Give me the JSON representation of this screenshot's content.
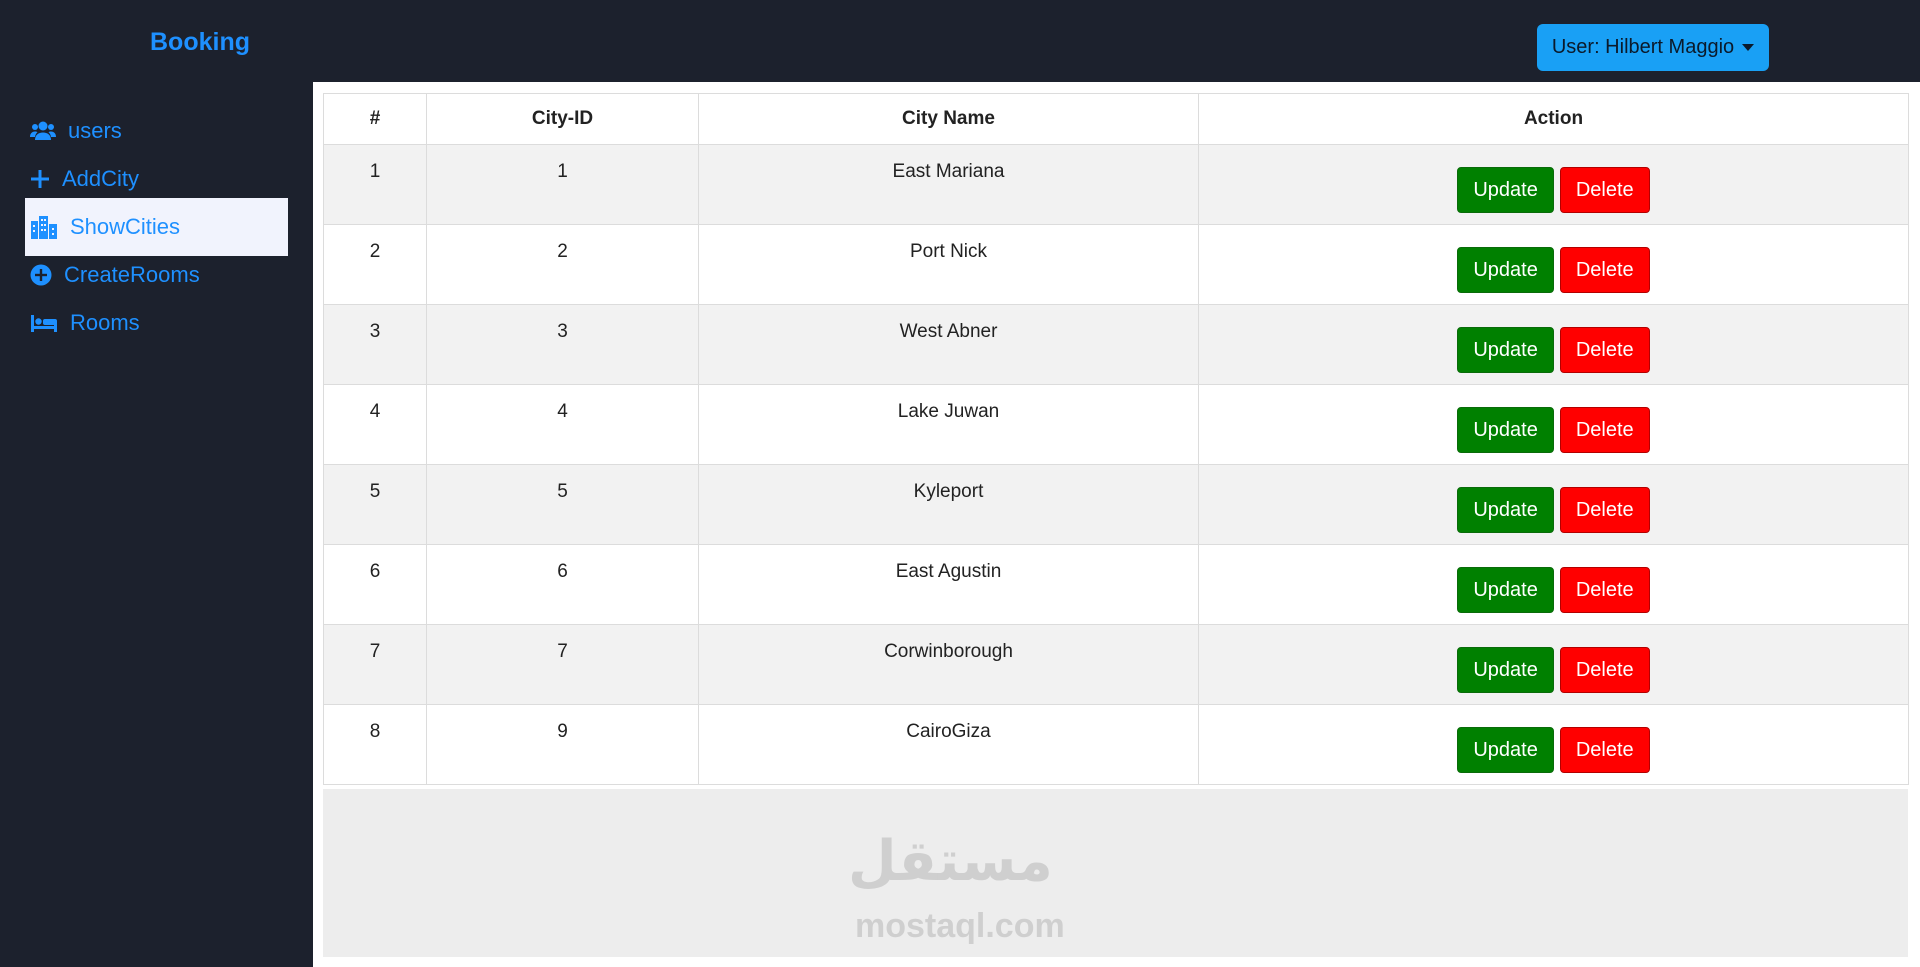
{
  "brand": "Booking",
  "user_menu": {
    "label": "User: Hilbert Maggio"
  },
  "sidebar": {
    "items": [
      {
        "label": "users",
        "icon": "users-icon"
      },
      {
        "label": "AddCity",
        "icon": "plus-icon"
      },
      {
        "label": "ShowCities",
        "icon": "city-icon",
        "active": true
      },
      {
        "label": "CreateRooms",
        "icon": "plus-circle-icon"
      },
      {
        "label": "Rooms",
        "icon": "bed-icon"
      }
    ]
  },
  "table": {
    "headers": [
      "#",
      "City-ID",
      "City Name",
      "Action"
    ],
    "rows": [
      {
        "index": "1",
        "city_id": "1",
        "city_name": "East Mariana"
      },
      {
        "index": "2",
        "city_id": "2",
        "city_name": "Port Nick"
      },
      {
        "index": "3",
        "city_id": "3",
        "city_name": "West Abner"
      },
      {
        "index": "4",
        "city_id": "4",
        "city_name": "Lake Juwan"
      },
      {
        "index": "5",
        "city_id": "5",
        "city_name": "Kyleport"
      },
      {
        "index": "6",
        "city_id": "6",
        "city_name": "East Agustin"
      },
      {
        "index": "7",
        "city_id": "7",
        "city_name": "Corwinborough"
      },
      {
        "index": "8",
        "city_id": "9",
        "city_name": "CairoGiza"
      }
    ],
    "update_label": "Update",
    "delete_label": "Delete"
  },
  "watermark": {
    "arabic": "مستقل",
    "latin": "mostaql.com"
  },
  "colors": {
    "accent": "#1e90ff",
    "sidebar_bg": "#1c212d",
    "update": "#008000",
    "delete": "#ff0000",
    "user_button": "#19a0f5"
  }
}
